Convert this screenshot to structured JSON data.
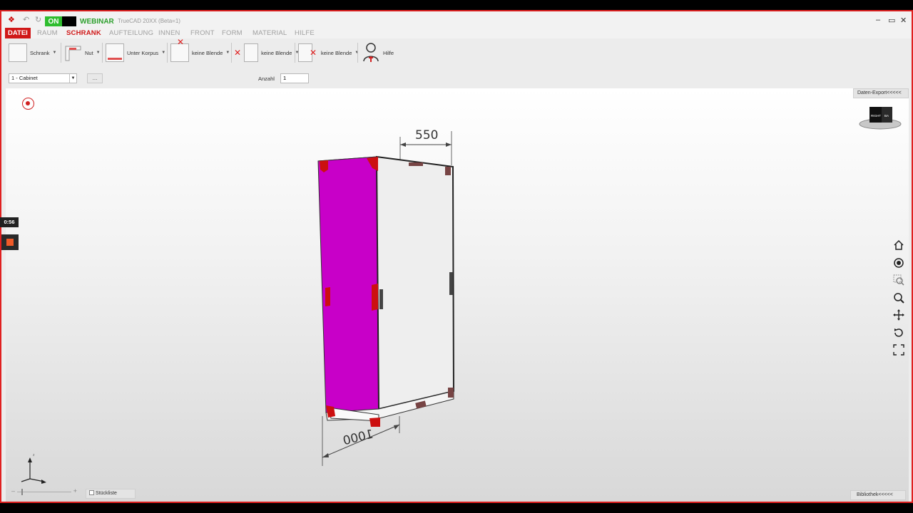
{
  "titlebar": {
    "on_label": "ON",
    "webinar_label": "WEBINAR",
    "app_title": "TrueCAD 20XX (Beta=1)",
    "window_controls": [
      "–",
      "▭",
      "✕"
    ]
  },
  "menu": {
    "items": [
      "DATEI",
      "RAUM",
      "SCHRANK",
      "AUFTEILUNG",
      "INNEN",
      "FRONT",
      "FORM",
      "MATERIAL",
      "HILFE"
    ],
    "active": "SCHRANK"
  },
  "ribbon": {
    "schrank": "Schrank",
    "nut": "Nut",
    "unter_korpus": "Unter Korpus",
    "blende1": "keine Blende",
    "blende2": "keine Blende",
    "blende3": "keine Blende",
    "hilfe": "Hilfe"
  },
  "row2": {
    "cabinet_select": "1 - Cabinet",
    "dots_button": "...",
    "anzahl_label": "Anzahl",
    "anzahl_value": "1"
  },
  "viewport": {
    "export_tab": "Daten-Export<<<<<",
    "library_tab": "Bibliothek<<<<<",
    "stueckliste": "Stückliste",
    "dimension_width": "550",
    "dimension_depth": "1000",
    "cube_labels": [
      "RIGHT",
      "BA"
    ],
    "colors": {
      "side_panel": "#c800c8",
      "front_panel": "#eeeeee",
      "corner_markers": "#cc1010",
      "accent": "#d01818"
    }
  },
  "recorder": {
    "time": "0:56"
  },
  "icons": {
    "nav": [
      "home-icon",
      "orbit-icon",
      "zoom-window-icon",
      "zoom-icon",
      "pan-icon",
      "rotate-icon",
      "fit-extents-icon"
    ]
  }
}
